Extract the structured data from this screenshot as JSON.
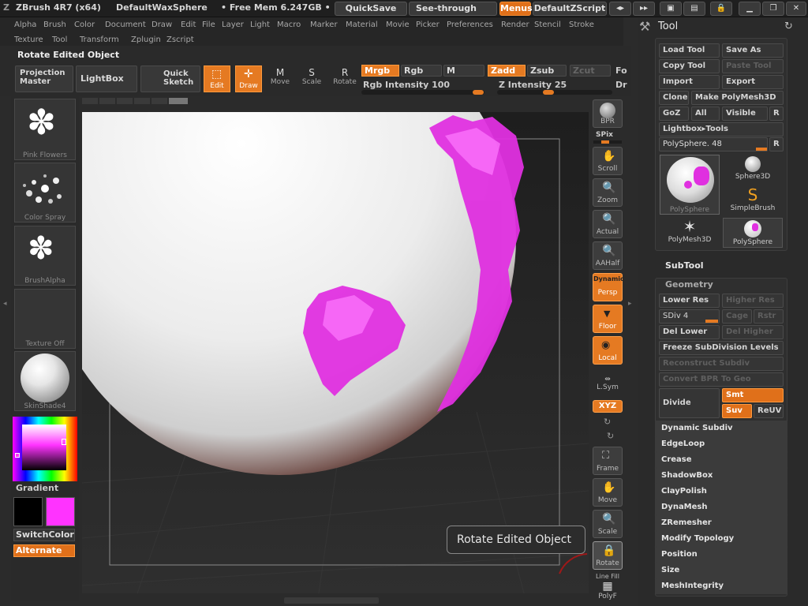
{
  "titlebar": {
    "app": "ZBrush 4R7 (x64)",
    "doc": "DefaultWaxSphere",
    "mem": "• Free Mem 6.247GB •",
    "quicksave": "QuickSave",
    "seethrough": "See-through",
    "seethrough_val": "0",
    "menus": "Menus",
    "script": "DefaultZScript"
  },
  "menus": [
    "Alpha",
    "Brush",
    "Color",
    "Document",
    "Draw",
    "Edit",
    "File",
    "Layer",
    "Light",
    "Macro",
    "Marker",
    "Material",
    "Movie",
    "Picker",
    "Preferences",
    "Render",
    "Stencil",
    "Stroke"
  ],
  "menus2": [
    "Texture",
    "Tool",
    "Transform",
    "Zplugin",
    "Zscript"
  ],
  "status_title": "Rotate Edited Object",
  "header": {
    "projection_master": "Projection Master",
    "lightbox": "LightBox",
    "quick_sketch": "Quick Sketch",
    "edit": "Edit",
    "draw": "Draw",
    "move": "Move",
    "scale": "Scale",
    "rotate": "Rotate",
    "mrgb": "Mrgb",
    "rgb": "Rgb",
    "m": "M",
    "zadd": "Zadd",
    "zsub": "Zsub",
    "zcut": "Zcut",
    "rgb_intensity": "Rgb Intensity 100",
    "z_intensity": "Z Intensity 25",
    "rgb_intensity_value": 100,
    "z_intensity_value": 25
  },
  "left": {
    "brush": "Pink Flowers",
    "stroke": "Color Spray",
    "alpha": "BrushAlpha",
    "texture": "Texture Off",
    "material": "SkinShade4",
    "gradient": "Gradient",
    "switchcolor": "SwitchColor",
    "alternate": "Alternate",
    "main_color": "#000000",
    "secondary_color": "#ff33ff"
  },
  "shelf": {
    "bpr": "BPR",
    "spix": "SPix",
    "scroll": "Scroll",
    "zoom": "Zoom",
    "actual": "Actual",
    "aahalf": "AAHalf",
    "dynamic": "Dynamic",
    "persp": "Persp",
    "floor": "Floor",
    "local": "Local",
    "lsym": "L.Sym",
    "xyz": "XYZ",
    "frame": "Frame",
    "move": "Move",
    "scale": "Scale",
    "rotate": "Rotate",
    "linefill": "Line Fill",
    "polyf": "PolyF"
  },
  "tooltip": "Rotate Edited Object",
  "tool": {
    "title": "Tool",
    "load_tool": "Load Tool",
    "save_as": "Save As",
    "copy_tool": "Copy Tool",
    "paste_tool": "Paste Tool",
    "import": "Import",
    "export": "Export",
    "clone": "Clone",
    "make_polymesh": "Make PolyMesh3D",
    "goz": "GoZ",
    "all": "All",
    "visible": "Visible",
    "r": "R",
    "lightbox_tools": "Lightbox▸Tools",
    "polysphere_label": "PolySphere. 48",
    "current_tool": "PolySphere",
    "tools": [
      "Sphere3D",
      "SimpleBrush",
      "PolyMesh3D",
      "PolySphere"
    ],
    "subtool": "SubTool",
    "geometry": "Geometry",
    "lower_res": "Lower Res",
    "higher_res": "Higher Res",
    "sdiv": "SDiv 4",
    "cage": "Cage",
    "rstr": "Rstr",
    "del_lower": "Del Lower",
    "del_higher": "Del Higher",
    "freeze": "Freeze SubDivision Levels",
    "reconstruct": "Reconstruct Subdiv",
    "convert_bpr": "Convert BPR To Geo",
    "divide": "Divide",
    "smt": "Smt",
    "suv": "Suv",
    "reuv": "ReUV",
    "sections": [
      "Dynamic Subdiv",
      "EdgeLoop",
      "Crease",
      "ShadowBox",
      "ClayPolish",
      "DynaMesh",
      "ZRemesher",
      "Modify Topology",
      "Position",
      "Size",
      "MeshIntegrity"
    ]
  }
}
